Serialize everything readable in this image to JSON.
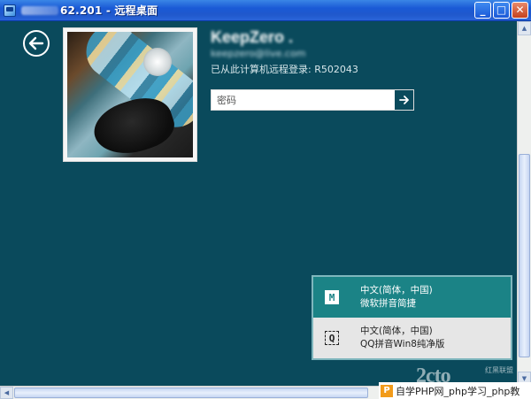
{
  "window": {
    "title": "62.201 - 远程桌面",
    "buttons": {
      "minimize": "_",
      "maximize": "□",
      "close": "✕"
    }
  },
  "login": {
    "user_name": "KeepZero .",
    "user_email": "keepzero@live.com",
    "login_note": "已从此计算机远程登录: R502043",
    "password_placeholder": "密码"
  },
  "ime_menu": {
    "items": [
      {
        "icon": "M",
        "line1": "中文(简体，中国)",
        "line2": "微软拼音简捷",
        "selected": true
      },
      {
        "icon": "Q",
        "line1": "中文(简体，中国)",
        "line2": "QQ拼音Win8纯净版",
        "selected": false
      }
    ]
  },
  "watermark": {
    "logo": "2cto",
    "sub": "红黑联盟",
    "bar_text": "自学PHP网_php学习_php教"
  },
  "colors": {
    "background": "#0a4a5c",
    "ime_selected": "#1b8386",
    "titlebar": "#1f58cc"
  }
}
